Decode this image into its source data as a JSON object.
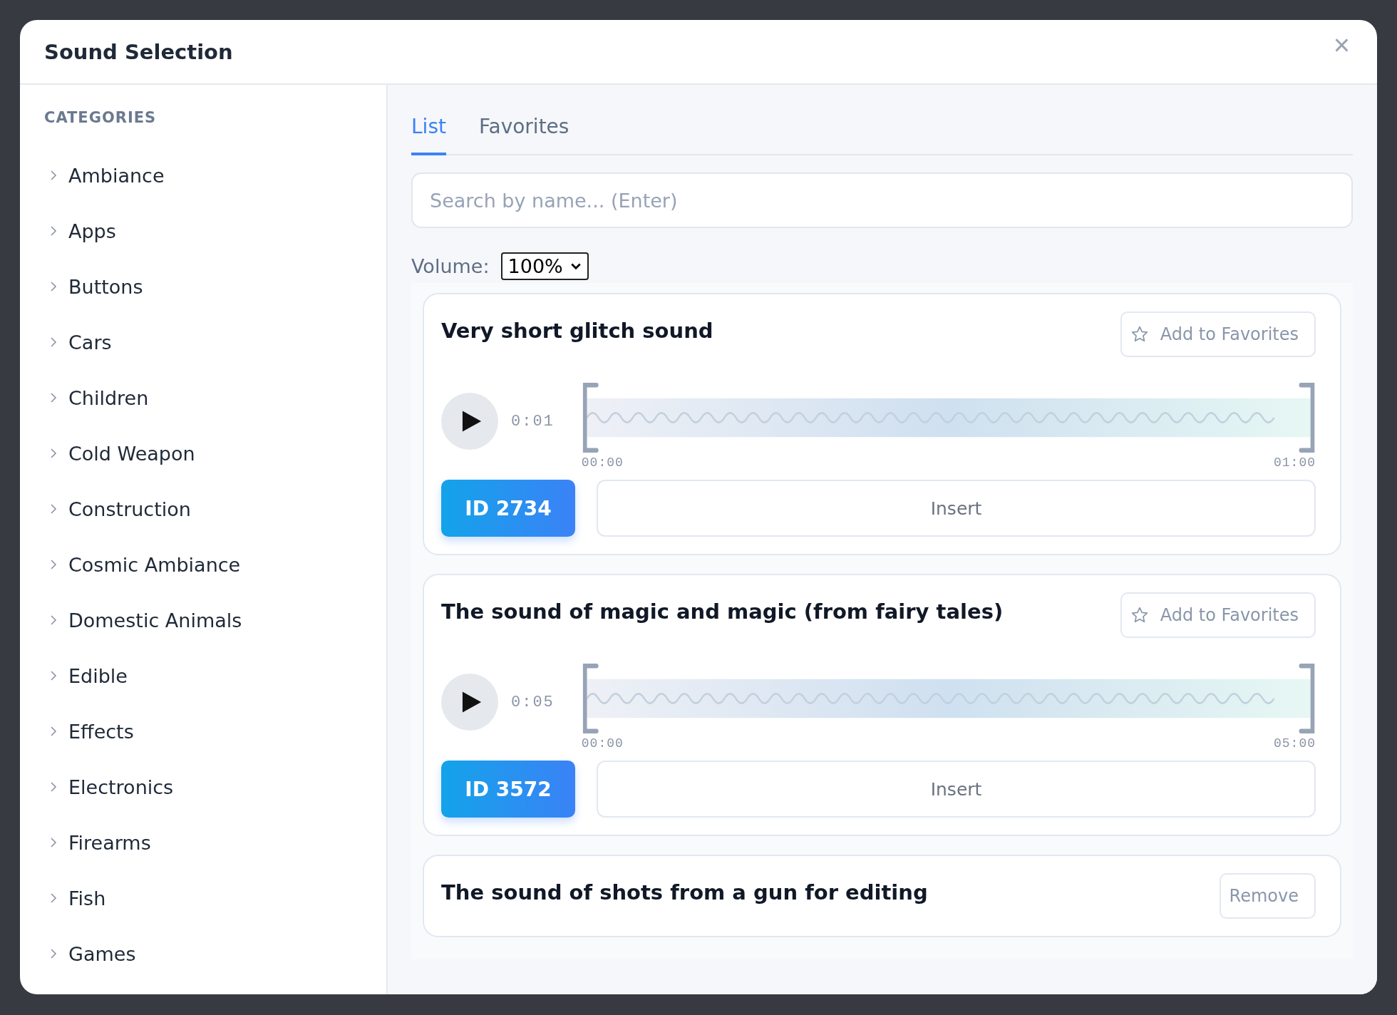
{
  "dialog": {
    "title": "Sound Selection",
    "close": "×"
  },
  "sidebar": {
    "heading": "CATEGORIES",
    "items": [
      {
        "label": "Ambiance",
        "expanded": false
      },
      {
        "label": "Apps",
        "expanded": false
      },
      {
        "label": "Buttons",
        "expanded": false
      },
      {
        "label": "Cars",
        "expanded": false
      },
      {
        "label": "Children",
        "expanded": false
      },
      {
        "label": "Cold Weapon",
        "expanded": false
      },
      {
        "label": "Construction",
        "expanded": false
      },
      {
        "label": "Cosmic Ambiance",
        "expanded": false
      },
      {
        "label": "Domestic Animals",
        "expanded": false
      },
      {
        "label": "Edible",
        "expanded": false
      },
      {
        "label": "Effects",
        "expanded": false
      },
      {
        "label": "Electronics",
        "expanded": false
      },
      {
        "label": "Firearms",
        "expanded": false
      },
      {
        "label": "Fish",
        "expanded": false
      },
      {
        "label": "Games",
        "expanded": false
      }
    ]
  },
  "tabs": [
    {
      "label": "List",
      "selected": true
    },
    {
      "label": "Favorites",
      "selected": false
    }
  ],
  "search": {
    "placeholder": "Search by name... (Enter)"
  },
  "volume": {
    "label": "Volume:",
    "value": "100%"
  },
  "sounds": [
    {
      "title": "Very short glitch sound",
      "action": {
        "kind": "favorite",
        "label": "Add to Favorites"
      },
      "time": "0:01",
      "start": "00:00",
      "end": "01:00",
      "id": "ID 2734",
      "insert": "Insert"
    },
    {
      "title": "The sound of magic and magic (from fairy tales)",
      "action": {
        "kind": "favorite",
        "label": "Add to Favorites"
      },
      "time": "0:05",
      "start": "00:00",
      "end": "05:00",
      "id": "ID 3572",
      "insert": "Insert"
    },
    {
      "title": "The sound of shots from a gun for editing",
      "action": {
        "kind": "remove",
        "label": "Remove"
      }
    }
  ]
}
